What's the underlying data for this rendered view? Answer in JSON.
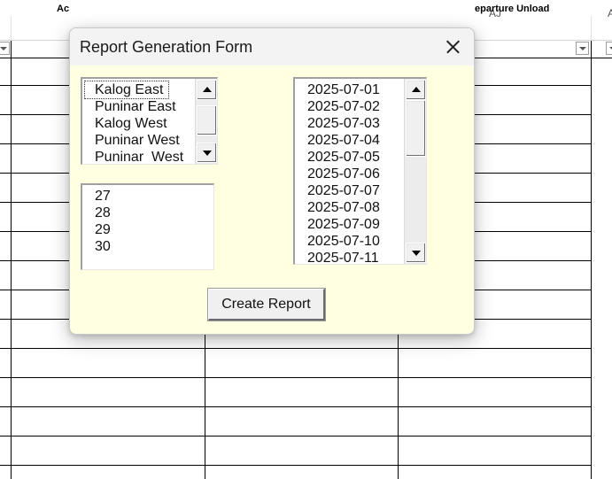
{
  "sheet": {
    "column_letters": {
      "aj": "AJ",
      "ak_partial": "A"
    },
    "table_headers": {
      "partial_left": "Ac",
      "departure_unload": "eparture Unload"
    }
  },
  "dialog": {
    "title": "Report Generation Form",
    "locations": {
      "items": [
        "Kalog East",
        "Puninar East",
        "Kalog West",
        "Puninar West",
        "Puninar  West"
      ],
      "focused_index": 0,
      "scroll_fraction": 0.4
    },
    "numbers": {
      "items": [
        "27",
        "28",
        "29",
        "30"
      ]
    },
    "dates": {
      "items": [
        "2025-07-01",
        "2025-07-02",
        "2025-07-03",
        "2025-07-04",
        "2025-07-05",
        "2025-07-06",
        "2025-07-07",
        "2025-07-08",
        "2025-07-09",
        "2025-07-10",
        "2025-07-11"
      ],
      "scroll_fraction": 0.0
    },
    "create_button_label": "Create Report"
  }
}
